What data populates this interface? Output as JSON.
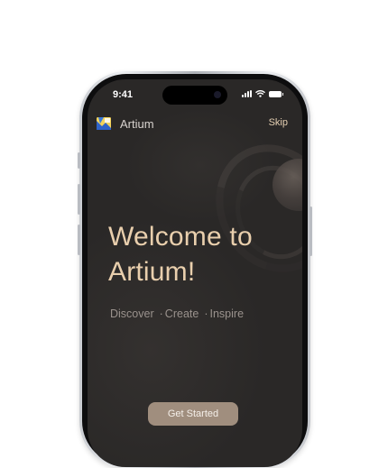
{
  "status_bar": {
    "time": "9:41",
    "signal_icon": "cellular-signal-icon",
    "wifi_icon": "wifi-icon",
    "battery_icon": "battery-icon"
  },
  "header": {
    "app_name": "Artium",
    "logo_icon": "artium-logo-icon",
    "skip_label": "Skip"
  },
  "hero": {
    "title_line1": "Welcome to",
    "title_line2": "Artium!",
    "tagline": [
      "Discover",
      "Create",
      "Inspire"
    ],
    "dot": "·"
  },
  "cta": {
    "label": "Get Started"
  },
  "colors": {
    "accent": "#e9cfad",
    "button_bg": "#a08e7e",
    "screen_bg": "#2a2827"
  }
}
